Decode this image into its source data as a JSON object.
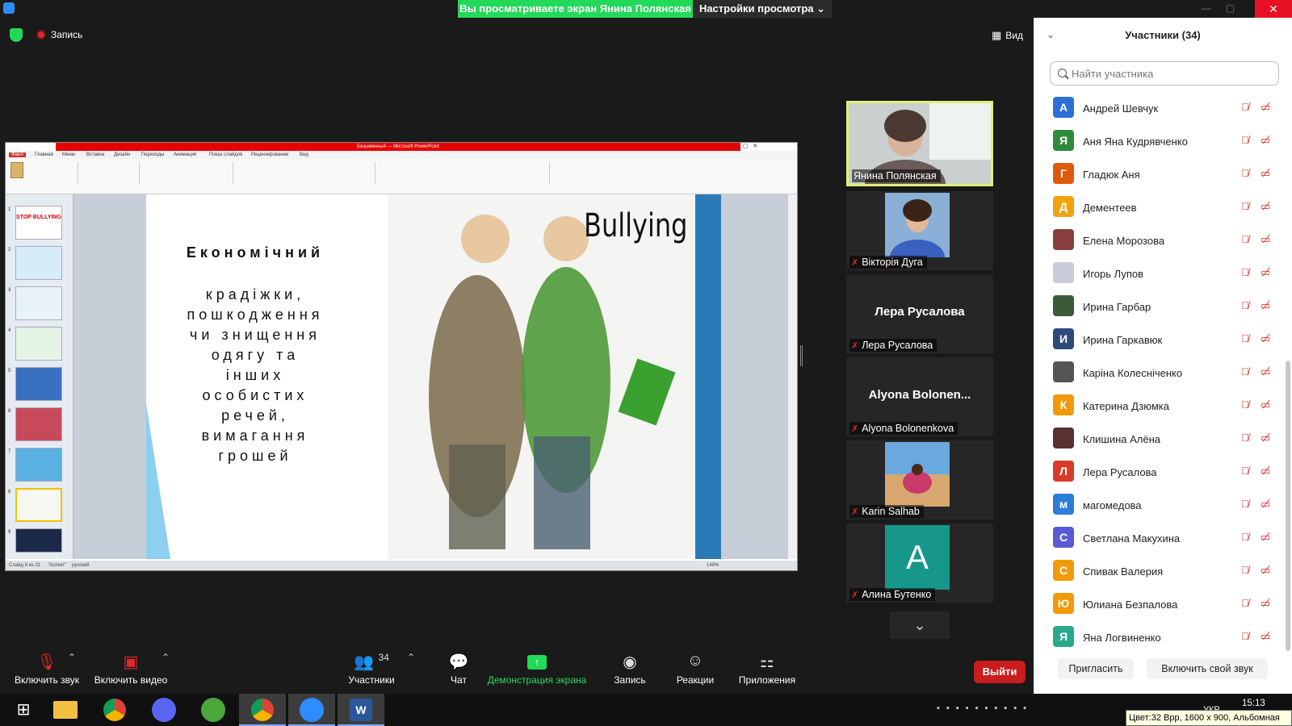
{
  "topbar": {
    "share_banner": "Вы просматриваете экран Янина Полянская",
    "view_settings": "Настройки просмотра",
    "close_symbol": "✕"
  },
  "meeting": {
    "recording_label": "Запись",
    "view_label": "Вид"
  },
  "slide": {
    "heading": "Економічний",
    "body_lines": [
      "крадіжки,",
      "пошкодження",
      "чи знищення",
      "одягу та",
      "інших",
      "особистих",
      "речей,",
      "вимагання",
      "грошей"
    ],
    "image_caption": "Bullying"
  },
  "ppt": {
    "title": "Безымянный — Microsoft PowerPoint",
    "tabs": [
      "Файл",
      "Главная",
      "Меню",
      "Вставка",
      "Дизайн",
      "Переходы",
      "Анимация",
      "Показ слайдов",
      "Рецензирование",
      "Вид"
    ],
    "status_slide": "Слайд 8 из 21",
    "status_theme": "\"Аспект\"",
    "status_lang": "русский",
    "zoom": "149%",
    "thumb_numbers": [
      "1",
      "2",
      "3",
      "4",
      "5",
      "6",
      "7",
      "8",
      "9"
    ],
    "thumb1_text": "STOP BULLYING"
  },
  "gallery": {
    "tiles": [
      {
        "name": "Янина Полянская"
      },
      {
        "name": "Вікторія Дуга"
      },
      {
        "name": "Лера Русалова",
        "center": "Лера Русалова"
      },
      {
        "name": "Alyona Bolonenkova",
        "center": "Alyona  Bolonen..."
      },
      {
        "name": "Karin Salhab"
      },
      {
        "name": "Алина Бутенко",
        "initial": "A"
      }
    ]
  },
  "participants": {
    "title": "Участники (34)",
    "search_placeholder": "Найти участника",
    "list": [
      {
        "initial": "А",
        "name": "Андрей Шевчук",
        "color": "#2d6fd6"
      },
      {
        "initial": "Я",
        "name": "Аня Яна Кудрявченко",
        "color": "#2e8b3a"
      },
      {
        "initial": "Г",
        "name": "Гладюк Аня",
        "color": "#e05a0c"
      },
      {
        "initial": "Д",
        "name": "Дементеев",
        "color": "#f2a20c"
      },
      {
        "initial": "",
        "name": "Елена Морозова",
        "color": "#8a3f3f"
      },
      {
        "initial": "",
        "name": "Игорь Лупов",
        "color": "#c8ccd8"
      },
      {
        "initial": "",
        "name": "Ирина Гарбар",
        "color": "#3c5a3a"
      },
      {
        "initial": "И",
        "name": "Ирина Гаркавюк",
        "color": "#2f4a7a"
      },
      {
        "initial": "",
        "name": "Каріна Колесніченко",
        "color": "#555555"
      },
      {
        "initial": "К",
        "name": "Катерина Дзюмка",
        "color": "#f29a0c"
      },
      {
        "initial": "",
        "name": "Клишина Алёна",
        "color": "#5a3030"
      },
      {
        "initial": "Л",
        "name": "Лера Русалова",
        "color": "#d93a2a"
      },
      {
        "initial": "м",
        "name": "магомедова",
        "color": "#2d7ed6"
      },
      {
        "initial": "С",
        "name": "Светлана Макухина",
        "color": "#5a5ad6"
      },
      {
        "initial": "С",
        "name": "Спивак Валерия",
        "color": "#f29a0c"
      },
      {
        "initial": "Ю",
        "name": "Юлиана Безпалова",
        "color": "#f29a0c"
      },
      {
        "initial": "Я",
        "name": "Яна Логвиненко",
        "color": "#2aa88a"
      }
    ],
    "invite_label": "Пригласить",
    "unmute_self_label": "Включить свой звук"
  },
  "toolbar": {
    "unmute_label": "Включить звук",
    "start_video_label": "Включить видео",
    "participants_label": "Участники",
    "participants_count": "34",
    "chat_label": "Чат",
    "share_label": "Демонстрация экрана",
    "record_label": "Запись",
    "reactions_label": "Реакции",
    "apps_label": "Приложения",
    "leave_label": "Выйти"
  },
  "taskbar": {
    "lang": "УКР",
    "time": "15:13",
    "tooltip": "Цвет:32 Bpp, 1600 x 900, Альбомная"
  },
  "colors": {
    "share_green": "#23d959",
    "leave_red": "#c91d1d",
    "active_speaker": "#dff276"
  }
}
